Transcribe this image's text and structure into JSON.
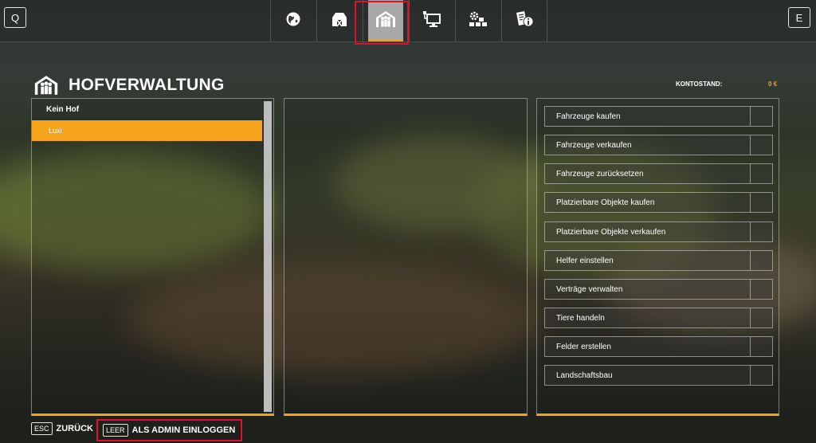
{
  "top_bar": {
    "left_key": "Q",
    "right_key": "E",
    "tabs": [
      {
        "icon": "globe-icon"
      },
      {
        "icon": "barn-icon"
      },
      {
        "icon": "farm-management-icon",
        "active": true
      },
      {
        "icon": "monitor-network-icon"
      },
      {
        "icon": "production-icon"
      },
      {
        "icon": "info-document-icon"
      }
    ]
  },
  "header": {
    "title": "HOFVERWALTUNG",
    "balance_label": "KONTOSTAND:",
    "balance_value": "0 €"
  },
  "farms": {
    "header": "Kein Hof",
    "items": [
      {
        "label": "Luxi",
        "selected": true
      }
    ]
  },
  "actions": [
    {
      "label": "Fahrzeuge kaufen"
    },
    {
      "label": "Fahrzeuge verkaufen"
    },
    {
      "label": "Fahrzeuge zurücksetzen"
    },
    {
      "label": "Platzierbare Objekte kaufen"
    },
    {
      "label": "Platzierbare Objekte verkaufen"
    },
    {
      "label": "Helfer einstellen"
    },
    {
      "label": "Verträge verwalten"
    },
    {
      "label": "Tiere handeln"
    },
    {
      "label": "Felder erstellen"
    },
    {
      "label": "Landschaftsbau"
    }
  ],
  "bottom_bar": {
    "back_key": "ESC",
    "back_label": "ZURÜCK",
    "admin_key": "LEER",
    "admin_label": "ALS ADMIN EINLOGGEN"
  },
  "colors": {
    "accent": "#f5a31a",
    "highlight_outline": "#e0102c"
  }
}
